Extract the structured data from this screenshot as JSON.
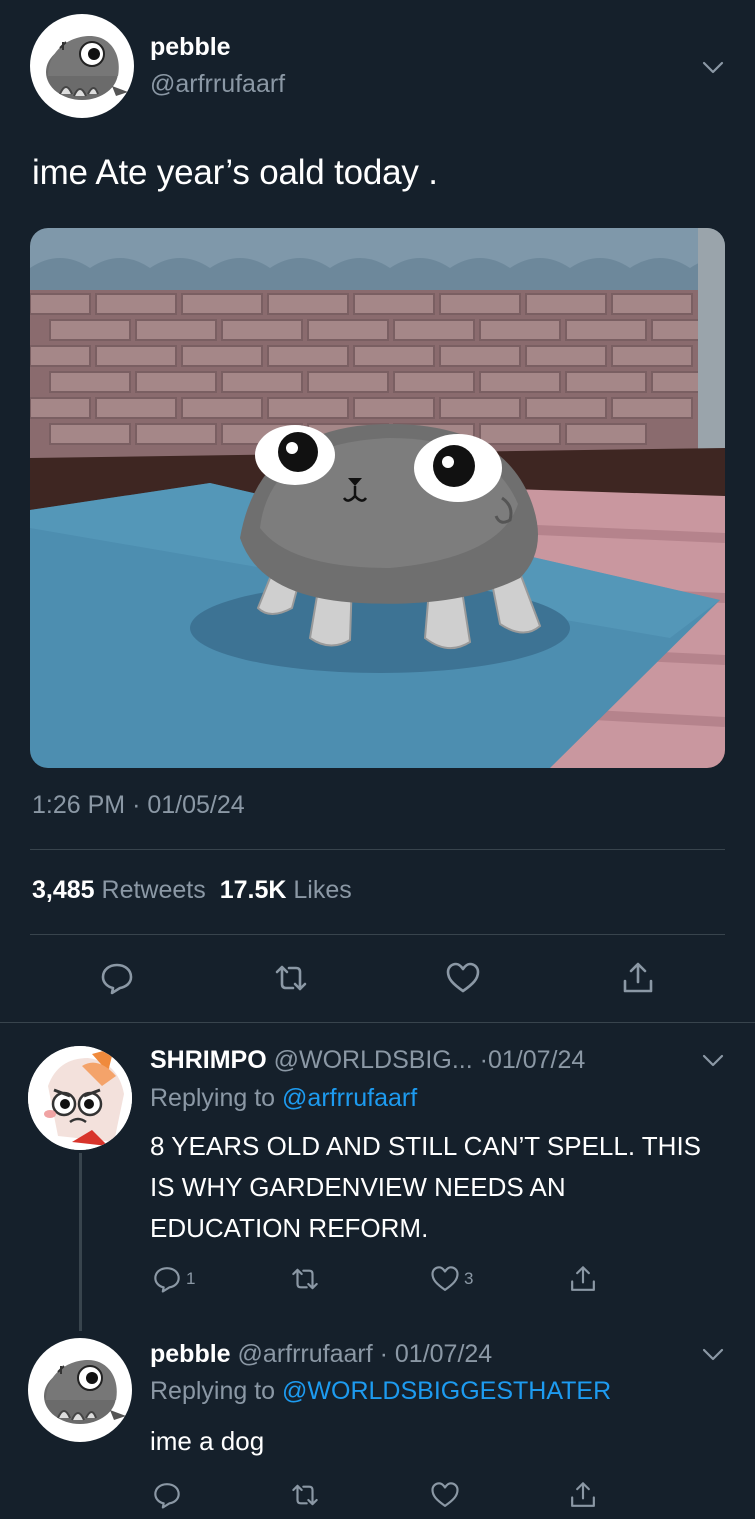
{
  "tweet": {
    "display_name": "pebble",
    "handle": "@arfrrufaarf",
    "text": "ime Ate year’s oald today .",
    "time": "1:26 PM",
    "date": "01/05/24",
    "retweets_count": "3,485",
    "retweets_label": "Retweets",
    "likes_count": "17.5K",
    "likes_label": "Likes",
    "image_alt": "3D gray rock-shaped creature with googly eyes sitting on a blue mat"
  },
  "replies": [
    {
      "display_name": "SHRIMPO",
      "handle": "@WORLDSBIG...",
      "date": "01/07/24",
      "replying_label": "Replying to",
      "replying_to": "@arfrrufaarf",
      "text": "8 YEARS OLD AND STILL CAN’T SPELL. THIS IS WHY GARDENVIEW NEEDS AN EDUCATION REFORM.",
      "reply_count": "1",
      "like_count": "3"
    },
    {
      "display_name": "pebble",
      "handle": "@arfrrufaarf",
      "date": "01/07/24",
      "replying_label": "Replying to",
      "replying_to": "@WORLDSBIGGESTHATER",
      "text": "ime a dog"
    }
  ],
  "colors": {
    "background": "#15202b",
    "secondary_text": "#8b98a5",
    "link": "#1d9bf0",
    "divider": "#38444d"
  },
  "icons": [
    "chevron-down-icon",
    "reply-icon",
    "retweet-icon",
    "like-icon",
    "share-icon"
  ]
}
